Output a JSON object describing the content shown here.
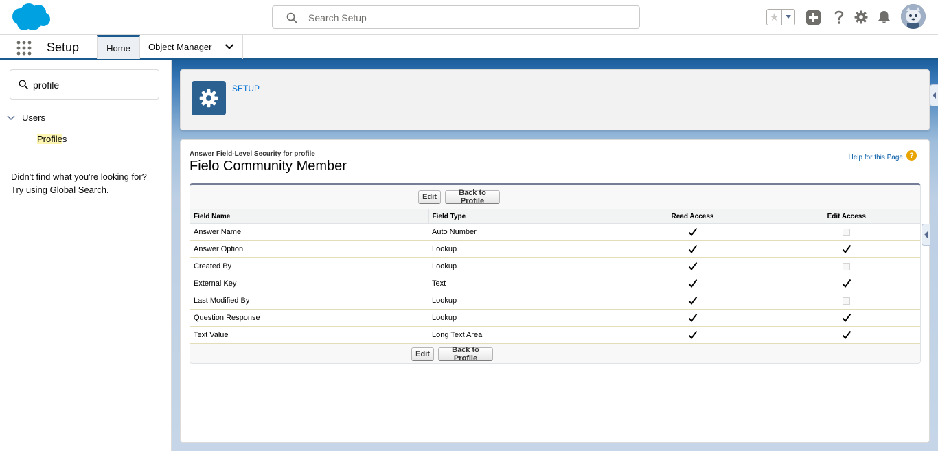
{
  "global_header": {
    "search_placeholder": "Search Setup",
    "icons": [
      "salesforce-logo",
      "star-icon",
      "chevron-down-icon",
      "plus-icon",
      "question-icon",
      "gear-icon",
      "bell-icon",
      "avatar"
    ]
  },
  "context_bar": {
    "app_name": "Setup",
    "tabs": [
      {
        "label": "Home",
        "active": true
      },
      {
        "label": "Object Manager",
        "active": false
      }
    ]
  },
  "sidebar": {
    "quickfind_value": "profile",
    "tree": {
      "group_label": "Users",
      "item_highlight": "Profile",
      "item_rest": "s"
    },
    "not_found_line1": "Didn't find what you're looking for?",
    "not_found_line2": "Try using Global Search."
  },
  "page_header": {
    "title": "SETUP"
  },
  "content": {
    "pre_title": "Answer Field-Level Security for profile",
    "title": "Fielo Community Member",
    "help_link": "Help for this Page",
    "help_icon": "?",
    "buttons": {
      "edit": "Edit",
      "back": "Back to Profile"
    },
    "columns": [
      "Field Name",
      "Field Type",
      "Read Access",
      "Edit Access"
    ],
    "rows": [
      {
        "field_name": "Answer Name",
        "field_type": "Auto Number",
        "read": true,
        "edit": false
      },
      {
        "field_name": "Answer Option",
        "field_type": "Lookup",
        "read": true,
        "edit": true
      },
      {
        "field_name": "Created By",
        "field_type": "Lookup",
        "read": true,
        "edit": false
      },
      {
        "field_name": "External Key",
        "field_type": "Text",
        "read": true,
        "edit": true
      },
      {
        "field_name": "Last Modified By",
        "field_type": "Lookup",
        "read": true,
        "edit": false
      },
      {
        "field_name": "Question Response",
        "field_type": "Lookup",
        "read": true,
        "edit": true
      },
      {
        "field_name": "Text Value",
        "field_type": "Long Text Area",
        "read": true,
        "edit": true
      }
    ]
  },
  "colors": {
    "brand_blue": "#1b5a8e",
    "link_blue": "#0070d2",
    "setup_icon_bg": "#2a6190",
    "highlight": "#fdf6b2",
    "help_orange": "#e8a400"
  }
}
